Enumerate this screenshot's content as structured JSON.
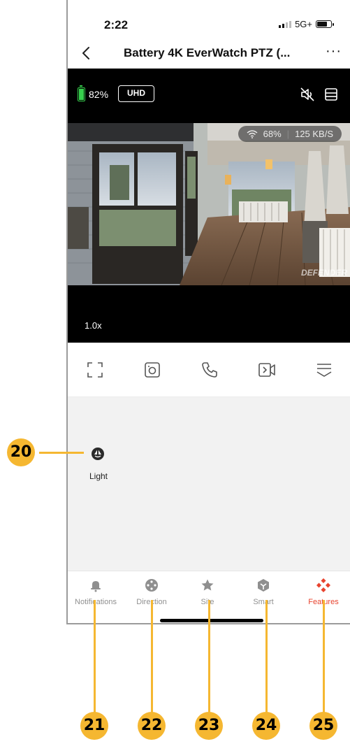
{
  "status_bar": {
    "time": "2:22",
    "network": "5G+"
  },
  "nav": {
    "title": "Battery 4K EverWatch PTZ (..."
  },
  "video": {
    "battery_percent": "82%",
    "quality_label": "UHD",
    "wifi_strength": "68%",
    "bitrate": "125 KB/S",
    "watermark": "DEFENDER",
    "zoom_level": "1.0x"
  },
  "features": {
    "light_label": "Light"
  },
  "tabs": [
    {
      "label": "Notifications",
      "icon": "bell-icon"
    },
    {
      "label": "Direction",
      "icon": "direction-pad-icon"
    },
    {
      "label": "Site",
      "icon": "star-icon"
    },
    {
      "label": "Smart",
      "icon": "shield-hexagon-icon"
    },
    {
      "label": "Features",
      "icon": "features-diamond-icon"
    }
  ],
  "colors": {
    "accent": "#e8432e",
    "callout": "#f5b731",
    "battery_green": "#37d04d"
  },
  "callouts": [
    "20",
    "21",
    "22",
    "23",
    "24",
    "25"
  ]
}
